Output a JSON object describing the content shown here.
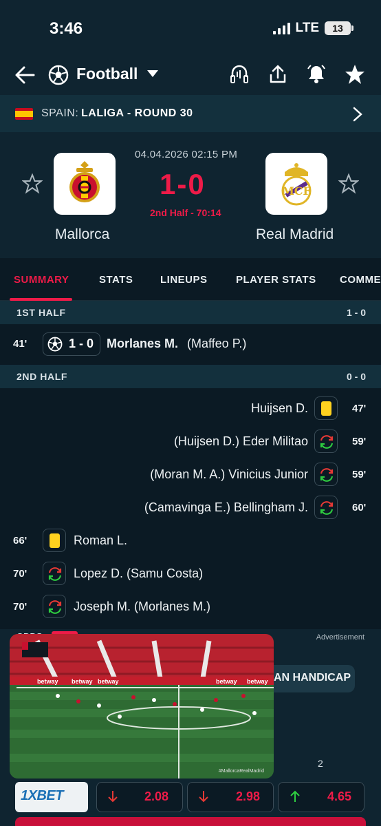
{
  "status_bar": {
    "time": "3:46",
    "network": "LTE",
    "battery": "13"
  },
  "nav": {
    "sport": "Football",
    "icons": [
      "back-arrow-icon",
      "football-icon",
      "caret-down-icon",
      "headphones-icon",
      "share-icon",
      "notifications-icon",
      "favorite-star-icon"
    ]
  },
  "league": {
    "country": "SPAIN:",
    "name": "LALIGA - ROUND 30"
  },
  "match": {
    "date": "04.04.2026 02:15 PM",
    "score": "1-0",
    "state": "2nd Half - 70:14",
    "home_team": "Mallorca",
    "away_team": "Real Madrid"
  },
  "tabs": [
    "SUMMARY",
    "STATS",
    "LINEUPS",
    "PLAYER STATS",
    "COMME"
  ],
  "active_tab": "SUMMARY",
  "first_half": {
    "title": "1ST HALF",
    "score": "1 - 0",
    "events": [
      {
        "minute": "41'",
        "type": "goal",
        "score": "1 - 0",
        "player": "Morlanes M.",
        "assist": "(Maffeo P.)"
      }
    ]
  },
  "second_half": {
    "title": "2ND HALF",
    "score": "0 - 0",
    "away_events": [
      {
        "minute": "47'",
        "type": "yellow-card",
        "text": "Huijsen D."
      },
      {
        "minute": "59'",
        "type": "substitution",
        "text": "(Huijsen D.)  Eder Militao"
      },
      {
        "minute": "59'",
        "type": "substitution",
        "text": "(Moran M. A.)  Vinicius Junior"
      },
      {
        "minute": "60'",
        "type": "substitution",
        "text": "(Camavinga E.)  Bellingham J."
      }
    ],
    "home_events": [
      {
        "minute": "66'",
        "type": "yellow-card",
        "text": "Roman L."
      },
      {
        "minute": "70'",
        "type": "substitution",
        "text": "Lopez D.  (Samu Costa)"
      },
      {
        "minute": "70'",
        "type": "substitution",
        "text": "Joseph M.  (Morlanes M.)"
      }
    ]
  },
  "odds": {
    "section_title": "ODDS",
    "ad_label": "Advertisement",
    "handicap_label": "AN HANDICAP",
    "column_header": "2",
    "bookmaker": "1XBET",
    "values": [
      {
        "value": "2.08",
        "trend": "down"
      },
      {
        "value": "2.98",
        "trend": "down"
      },
      {
        "value": "4.65",
        "trend": "up"
      }
    ]
  },
  "video_overlay": {
    "watermark": "#MallorcaRealMadrid",
    "sponsor_boards": [
      "betway",
      "betway",
      "betway",
      "betway",
      "betway"
    ]
  },
  "colors": {
    "accent": "#ee1b48",
    "background": "#0b1a24",
    "header": "#0f2430",
    "section": "#13303d",
    "yellow_card": "#ffd21f",
    "odds_up": "#2ecc40"
  }
}
